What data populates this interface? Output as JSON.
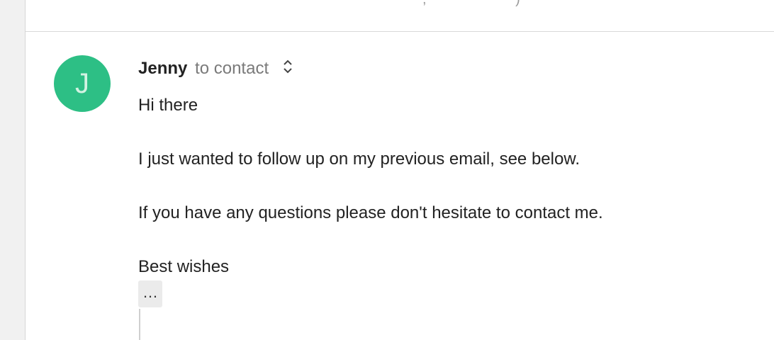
{
  "message": {
    "avatar_initial": "J",
    "sender": "Jenny",
    "recipient_text": "to contact",
    "body_lines": [
      "Hi there",
      "I just wanted to follow up on my previous email, see below.",
      "If you have any questions please don't hesitate to contact me.",
      "Best wishes"
    ],
    "show_trimmed_label": "…"
  },
  "colors": {
    "avatar_bg": "#2dbf85",
    "avatar_text": "#d2f2e2",
    "sender_text": "#222222",
    "recipient_text": "#7a7a7a"
  },
  "icons": {
    "details_toggle": "chevron-up-down-icon"
  }
}
